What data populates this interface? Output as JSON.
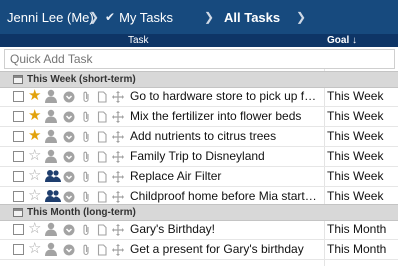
{
  "breadcrumb": {
    "user": "Jenni Lee (Me)",
    "my_tasks": "My Tasks",
    "all_tasks": "All Tasks"
  },
  "columns": {
    "task": "Task",
    "goal": "Goal ↓"
  },
  "quick_add": {
    "placeholder": "Quick Add Task"
  },
  "sections": [
    {
      "label": "This Week (short-term)"
    },
    {
      "label": "This Month (long-term)"
    }
  ],
  "rows": [
    {
      "title": "Go to hardware store to pick up fertilizer",
      "goal": "This Week",
      "starred": true,
      "assignee": "single"
    },
    {
      "title": "Mix the fertilizer into flower beds",
      "goal": "This Week",
      "starred": true,
      "assignee": "single"
    },
    {
      "title": "Add nutrients to citrus trees",
      "goal": "This Week",
      "starred": true,
      "assignee": "single"
    },
    {
      "title": "Family Trip to Disneyland",
      "goal": "This Week",
      "starred": false,
      "assignee": "single"
    },
    {
      "title": "Replace Air Filter",
      "goal": "This Week",
      "starred": false,
      "assignee": "group"
    },
    {
      "title": "Childproof home before Mia starts walking",
      "goal": "This Week",
      "starred": false,
      "assignee": "group"
    },
    {
      "title": "Gary's Birthday!",
      "goal": "This Month",
      "starred": false,
      "assignee": "single"
    },
    {
      "title": "Get a present for Gary's birthday",
      "goal": "This Month",
      "starred": false,
      "assignee": "single"
    }
  ],
  "colors": {
    "breadcrumb_bg": "#174a7e",
    "header_bg": "#0e3566",
    "section_bg": "#d8d8d8",
    "star_on": "#e2a20c",
    "star_off": "#a9a9a9",
    "assignee_group": "#1f3e6e"
  },
  "icons": {
    "row": [
      "checkbox",
      "star-icon",
      "person-icon",
      "status-icon",
      "attachment-icon",
      "note-icon",
      "drag-handle-icon"
    ],
    "section": "calendar-icon",
    "breadcrumb_separator": "chevron-right-icon",
    "my_tasks": "checkmark-icon"
  }
}
